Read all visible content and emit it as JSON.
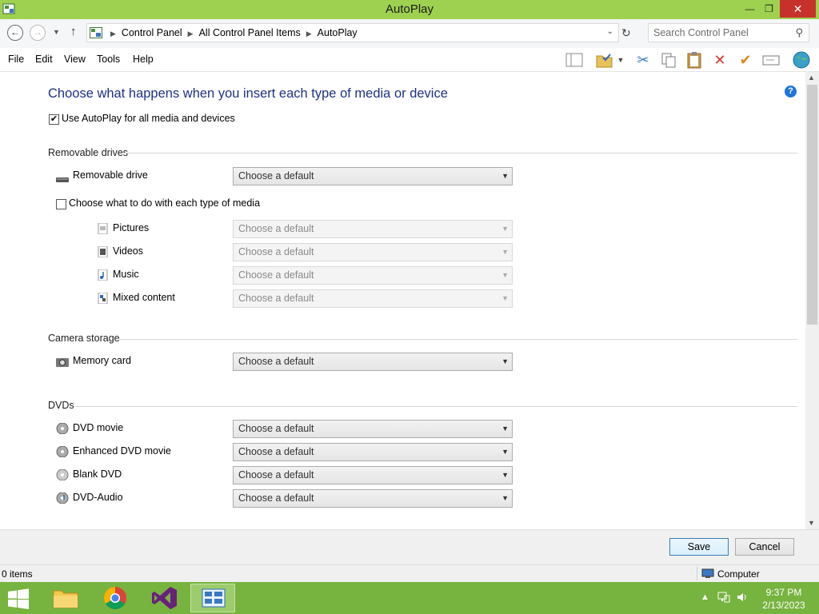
{
  "window": {
    "title": "AutoPlay"
  },
  "window_controls": {
    "minimize": "—",
    "maximize": "❐",
    "close": "✕"
  },
  "address": {
    "crumbs": [
      "Control Panel",
      "All Control Panel Items",
      "AutoPlay"
    ],
    "search_placeholder": "Search Control Panel"
  },
  "menu": {
    "file": "File",
    "edit": "Edit",
    "view": "View",
    "tools": "Tools",
    "help": "Help"
  },
  "toolbar_icons": [
    "layout-icon",
    "folder-check-icon",
    "cut-icon",
    "copy-icon",
    "paste-icon",
    "delete-icon",
    "checkmark-icon",
    "rename-icon",
    "globe-icon"
  ],
  "content": {
    "heading": "Choose what happens when you insert each type of media or device",
    "use_autoplay_label": "Use AutoPlay for all media and devices",
    "use_autoplay_checked": true,
    "sections": {
      "removable": "Removable drives",
      "camera": "Camera storage",
      "dvds": "DVDs"
    },
    "removable_drive": "Removable drive",
    "each_media_label": "Choose what to do with each type of media",
    "each_media_checked": false,
    "media_types": {
      "pictures": "Pictures",
      "videos": "Videos",
      "music": "Music",
      "mixed": "Mixed content"
    },
    "memory_card": "Memory card",
    "dvd": {
      "movie": "DVD movie",
      "enhanced": "Enhanced DVD movie",
      "blank": "Blank DVD",
      "audio": "DVD-Audio"
    },
    "default_option": "Choose a default"
  },
  "buttons": {
    "save": "Save",
    "cancel": "Cancel"
  },
  "status": {
    "items": "0 items",
    "location": "Computer"
  },
  "clock": {
    "time": "9:37 PM",
    "date": "2/13/2023"
  },
  "colors": {
    "titlebar": "#9ed150",
    "taskbar": "#77b33f",
    "heading": "#1e3287",
    "close": "#c7312c"
  }
}
